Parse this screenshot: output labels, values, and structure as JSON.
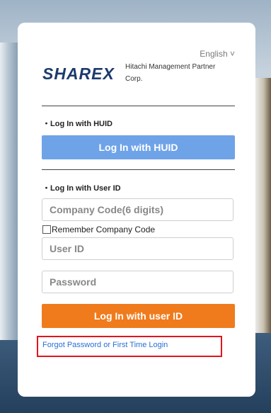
{
  "language": {
    "label": "English",
    "chevron": "˅"
  },
  "brand": {
    "logo_text": "SHAREX",
    "company_line1": "Hitachi Management Partner",
    "company_line2": "Corp."
  },
  "huid_section": {
    "label": "・Log In with HUID",
    "button": "Log In with HUID"
  },
  "userid_section": {
    "label": "・Log In with User ID",
    "company_code_placeholder": "Company Code(6 digits)",
    "remember_label": "Remember Company Code",
    "user_id_placeholder": "User ID",
    "password_placeholder": "Password",
    "button": "Log In with user ID"
  },
  "forgot_link": "Forgot Password or First Time Login",
  "colors": {
    "huid_button": "#6fa3e8",
    "login_button": "#f07b1c",
    "link": "#2a6fd6",
    "highlight": "#e0151d",
    "brand": "#1d3a6d"
  }
}
